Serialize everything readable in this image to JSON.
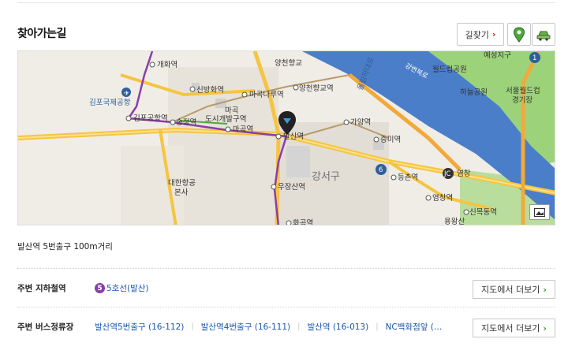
{
  "section": {
    "title": "찾아가는길"
  },
  "toolbar": {
    "route_label": "길찾기",
    "route_chevron": "›",
    "pin_icon": "map-pin-icon",
    "car_icon": "car-icon"
  },
  "map": {
    "labels": {
      "gaehwa": "개화역",
      "yangcheon_hs": "양천향교",
      "yangcheon_station": "양천향교역",
      "sinbang": "신방화역",
      "magoknaru": "마곡나루역",
      "airport": "김포국제공항",
      "gimpo_station": "김포공항역",
      "songjeong": "송정역",
      "dosi_balgu": "도시개발구역",
      "magok_small": "마곡",
      "magok_station": "마곡역",
      "balsan": "발산역",
      "gayang": "가양역",
      "jeungmi": "증미역",
      "gangseo": "강서구",
      "deungchon": "등촌역",
      "daehan_hq": "대한항공",
      "daehan_hq2": "본사",
      "ujangsan": "우장산역",
      "hwagok": "화곡역",
      "yeomchang": "염창역",
      "yeomchang_jc": "염창",
      "yongwangsan": "용왕산",
      "sinmokdong": "신목동역",
      "worldcup_park": "월드컵공원",
      "haneul_park": "하늘공원",
      "seoul_worldcup": "서울월드컵",
      "stadium": "경기장",
      "yeonseong": "예성지구",
      "gangbyeon": "강변북로",
      "olympic": "올림픽대로",
      "jc": "JC",
      "route1": "1",
      "route6": "6"
    },
    "control_icon": "map-type-icon"
  },
  "address": "발산역 5번출구 100m거리",
  "subway": {
    "label": "주변 지하철역",
    "line_number": "5",
    "line_name": "5호선(발산)",
    "more_label": "지도에서 더보기",
    "more_chevron": "›"
  },
  "bus": {
    "label": "주변 버스정류장",
    "stops": [
      "발산역5번출구 (16-112)",
      "발산역4번출구 (16-111)",
      "발산역 (16-013)",
      "NC백화점앞 (…"
    ],
    "more_label": "지도에서 더보기",
    "more_chevron": "›"
  },
  "colors": {
    "line5": "#8b3ea8",
    "river": "#4b7ec8",
    "park": "#9cd27a",
    "accent_red": "#d2141a",
    "link_blue": "#1a56b0"
  }
}
